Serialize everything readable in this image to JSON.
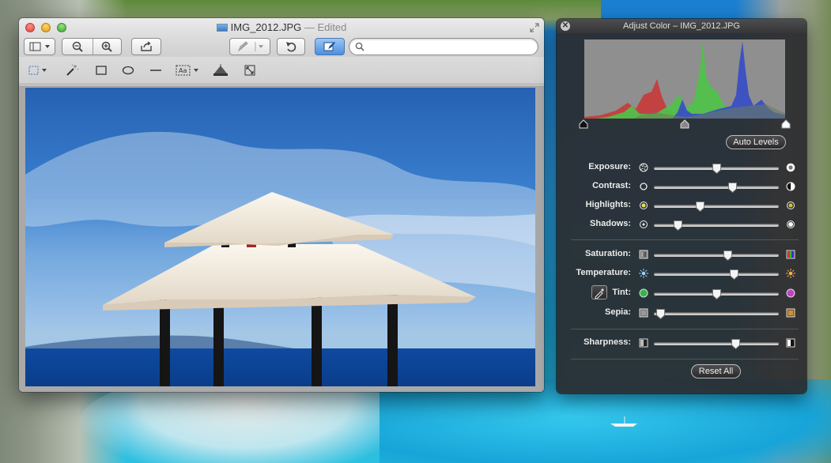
{
  "preview_window": {
    "title": "IMG_2012.JPG",
    "edited_suffix": "— Edited",
    "search": {
      "placeholder": "",
      "value": ""
    }
  },
  "adjust_panel": {
    "title": "Adjust Color – IMG_2012.JPG",
    "auto_levels_label": "Auto Levels",
    "reset_all_label": "Reset All",
    "sliders": [
      {
        "key": "exposure",
        "label": "Exposure:",
        "value": 0.5
      },
      {
        "key": "contrast",
        "label": "Contrast:",
        "value": 0.64
      },
      {
        "key": "highlights",
        "label": "Highlights:",
        "value": 0.36
      },
      {
        "key": "shadows",
        "label": "Shadows:",
        "value": 0.17
      },
      {
        "key": "saturation",
        "label": "Saturation:",
        "value": 0.6
      },
      {
        "key": "temperature",
        "label": "Temperature:",
        "value": 0.65
      },
      {
        "key": "tint",
        "label": "Tint:",
        "value": 0.5
      },
      {
        "key": "sepia",
        "label": "Sepia:",
        "value": 0.02
      },
      {
        "key": "sharpness",
        "label": "Sharpness:",
        "value": 0.67
      }
    ],
    "levels": {
      "black_point": 0.0,
      "midpoint": 0.5,
      "white_point": 1.0
    }
  },
  "colors": {
    "histogram_bg": "#8f8f8f",
    "hist_red": "#c83a3a",
    "hist_green": "#4fc24a",
    "hist_blue": "#3b4fc4",
    "panel_bg": "#2a2a2c"
  }
}
